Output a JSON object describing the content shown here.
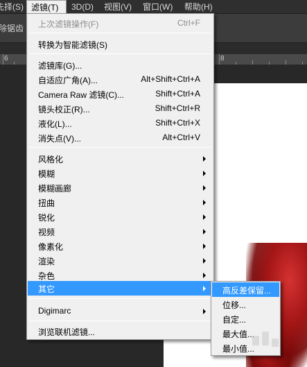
{
  "menubar": {
    "items": [
      {
        "label": "选择(S)",
        "visible": "先择(S)"
      },
      {
        "label": "滤镜(T)"
      },
      {
        "label": "3D(D)"
      },
      {
        "label": "视图(V)"
      },
      {
        "label": "窗口(W)"
      },
      {
        "label": "帮助(H)"
      }
    ]
  },
  "options_bar": {
    "label": "消除锯齿"
  },
  "ruler": {
    "labels": [
      "6",
      "8"
    ]
  },
  "filter_menu": {
    "items": [
      {
        "label": "上次滤镜操作(F)",
        "shortcut": "Ctrl+F",
        "disabled": true
      },
      {
        "label": "转换为智能滤镜(S)",
        "shortcut": ""
      },
      {
        "label": "滤镜库(G)...",
        "shortcut": ""
      },
      {
        "label": "自适应广角(A)...",
        "shortcut": "Alt+Shift+Ctrl+A"
      },
      {
        "label": "Camera Raw 滤镜(C)...",
        "shortcut": "Shift+Ctrl+A"
      },
      {
        "label": "镜头校正(R)...",
        "shortcut": "Shift+Ctrl+R"
      },
      {
        "label": "液化(L)...",
        "shortcut": "Shift+Ctrl+X"
      },
      {
        "label": "消失点(V)...",
        "shortcut": "Alt+Ctrl+V"
      },
      {
        "label": "风格化"
      },
      {
        "label": "模糊"
      },
      {
        "label": "模糊画廊"
      },
      {
        "label": "扭曲"
      },
      {
        "label": "锐化"
      },
      {
        "label": "视频"
      },
      {
        "label": "像素化"
      },
      {
        "label": "渲染"
      },
      {
        "label": "杂色"
      },
      {
        "label": "其它"
      },
      {
        "label": "Digimarc"
      },
      {
        "label": "浏览联机滤镜..."
      }
    ]
  },
  "other_submenu": {
    "items": [
      {
        "label": "高反差保留..."
      },
      {
        "label": "位移..."
      },
      {
        "label": "自定..."
      },
      {
        "label": "最大值..."
      },
      {
        "label": "最小值..."
      }
    ]
  },
  "colors": {
    "highlight": "#3399ff",
    "menu_bg": "#f0f0f0",
    "app_bg": "#282828",
    "photo_red": "#c41d1d"
  }
}
